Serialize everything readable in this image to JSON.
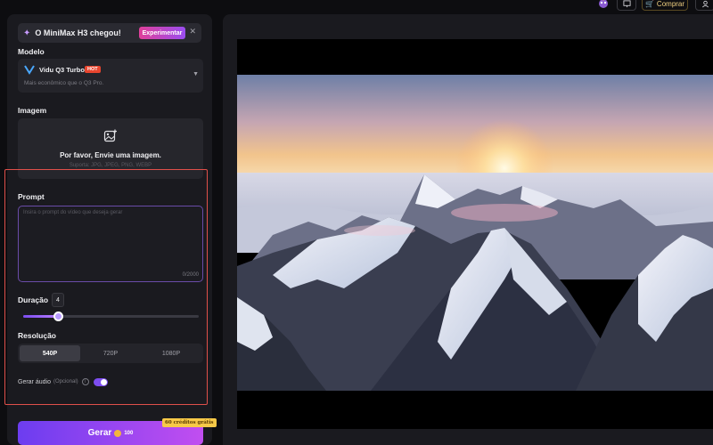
{
  "topbar": {
    "buy_label": "Comprar"
  },
  "banner": {
    "text": "O MiniMax H3 chegou!",
    "cta": "Experimentar"
  },
  "model": {
    "section_label": "Modelo",
    "name": "Vidu Q3 Turbo",
    "badge": "HOT",
    "description": "Mais econômico que o Q3 Pro."
  },
  "image": {
    "section_label": "Imagem",
    "upload_title": "Por favor, Envie uma imagem.",
    "formats": "Suporta: JPG, JPEG, PNG, WEBP"
  },
  "prompt": {
    "section_label": "Prompt",
    "placeholder": "Insira o prompt do vídeo que deseja gerar",
    "counter": "0/2000"
  },
  "duration": {
    "section_label": "Duração",
    "value": "4",
    "slider_fraction": 0.2
  },
  "resolution": {
    "section_label": "Resolução",
    "options": [
      "540P",
      "720P",
      "1080P"
    ],
    "selected": "540P"
  },
  "audio": {
    "label": "Gerar áudio",
    "optional": "(Opcional)",
    "enabled": true
  },
  "generate": {
    "label": "Gerar",
    "cost": "100",
    "free_badge": "60 créditos grátis"
  },
  "colors": {
    "accent": "#7d4df0",
    "highlight": "#e0504a",
    "hot": "#e8452e"
  }
}
